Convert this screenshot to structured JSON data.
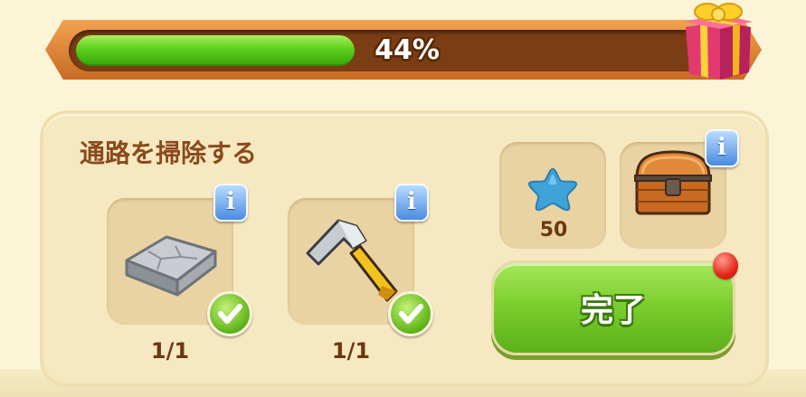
{
  "progress": {
    "value_percent": 44,
    "label": "44%"
  },
  "task": {
    "title": "通路を掃除する"
  },
  "requirements": [
    {
      "item": "stone-tile",
      "count": "1/1",
      "completed": true
    },
    {
      "item": "hammer",
      "count": "1/1",
      "completed": true
    }
  ],
  "rewards": [
    {
      "item": "blue-star",
      "amount": "50"
    },
    {
      "item": "treasure-chest"
    }
  ],
  "info_label": "i",
  "actions": {
    "complete_label": "完了"
  },
  "colors": {
    "progress_fill": "#5ccf1c",
    "banner": "#d9823a",
    "panel": "#f6e8c1",
    "title_text": "#8a4a1c",
    "complete_button": "#78cc2c",
    "notification_dot": "#e5261a"
  }
}
